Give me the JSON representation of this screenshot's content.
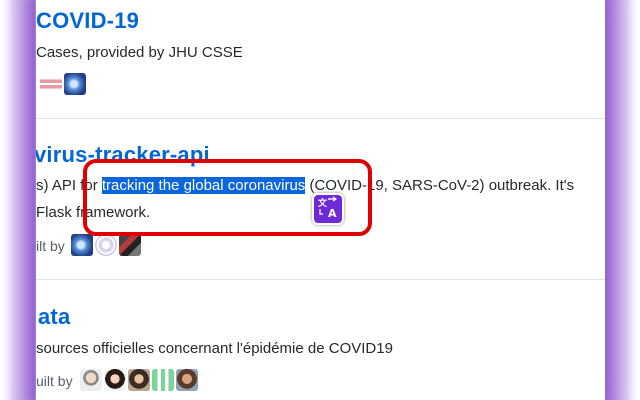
{
  "items": [
    {
      "title": "COVID-19",
      "description": "Cases, provided by JHU CSSE",
      "built_by": ""
    },
    {
      "title": "virus-tracker-api",
      "description_before": "s) API for ",
      "description_selected": "tracking the global coronavirus",
      "description_after": " (COVID-19, SARS-CoV-2) outbreak. It's",
      "description_line2": "Flask framework.",
      "built_by": "ilt by"
    },
    {
      "title": "ata",
      "description": "sources officielles concernant l'épidémie de COVID19",
      "built_by": "uilt by"
    }
  ],
  "translate_button": {
    "icon": "translate-icon",
    "accent": "#6f2ad8"
  },
  "highlight_color": "#0a66d9",
  "callout_color": "#e00000"
}
